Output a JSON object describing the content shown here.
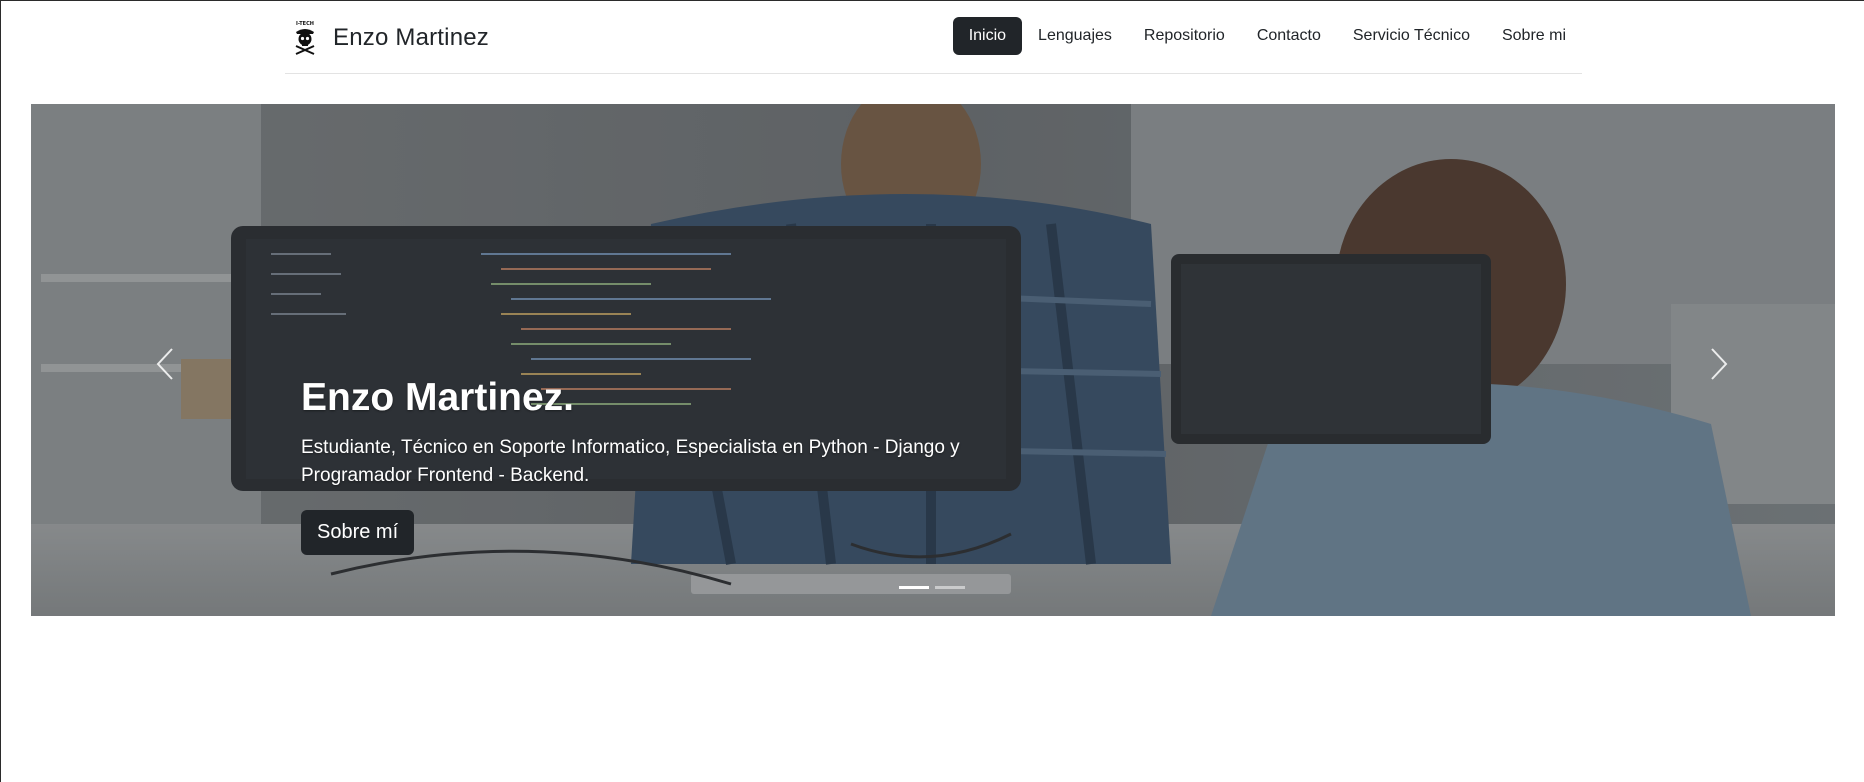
{
  "brand": {
    "logo_text": "I-TECH",
    "name": "Enzo Martinez"
  },
  "nav": {
    "items": [
      {
        "label": "Inicio",
        "active": true
      },
      {
        "label": "Lenguajes",
        "active": false
      },
      {
        "label": "Repositorio",
        "active": false
      },
      {
        "label": "Contacto",
        "active": false
      },
      {
        "label": "Servicio Técnico",
        "active": false
      },
      {
        "label": "Sobre mi",
        "active": false
      }
    ]
  },
  "carousel": {
    "slides": [
      {
        "title": "Enzo Martinez.",
        "text": "Estudiante, Técnico en Soporte Informatico, Especialista en Python - Django y Programador Frontend - Backend.",
        "button_label": "Sobre mí"
      }
    ],
    "indicator_count": 2,
    "active_index": 0,
    "prev_icon": "chevron-left-icon",
    "next_icon": "chevron-right-icon"
  },
  "colors": {
    "accent_dark": "#212529",
    "nav_text": "#212529",
    "caption_text": "#ffffff"
  }
}
